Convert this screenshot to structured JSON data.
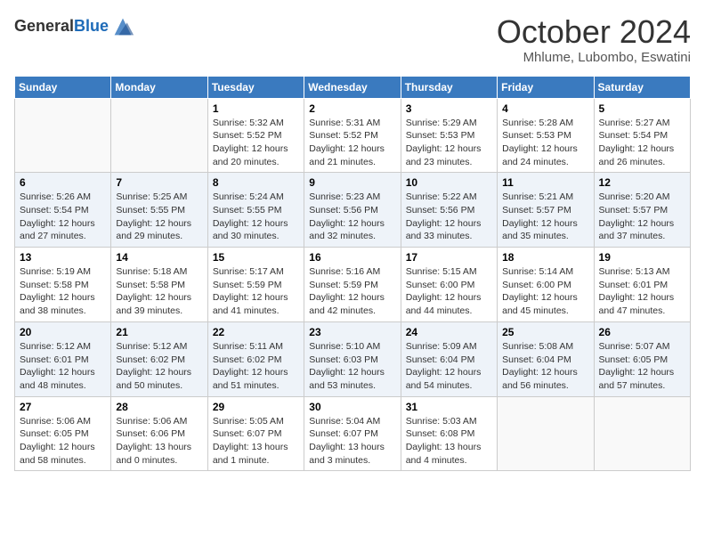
{
  "header": {
    "logo_general": "General",
    "logo_blue": "Blue",
    "month_title": "October 2024",
    "location": "Mhlume, Lubombo, Eswatini"
  },
  "weekdays": [
    "Sunday",
    "Monday",
    "Tuesday",
    "Wednesday",
    "Thursday",
    "Friday",
    "Saturday"
  ],
  "weeks": [
    [
      {
        "day": "",
        "sunrise": "",
        "sunset": "",
        "daylight": ""
      },
      {
        "day": "",
        "sunrise": "",
        "sunset": "",
        "daylight": ""
      },
      {
        "day": "1",
        "sunrise": "Sunrise: 5:32 AM",
        "sunset": "Sunset: 5:52 PM",
        "daylight": "Daylight: 12 hours and 20 minutes."
      },
      {
        "day": "2",
        "sunrise": "Sunrise: 5:31 AM",
        "sunset": "Sunset: 5:52 PM",
        "daylight": "Daylight: 12 hours and 21 minutes."
      },
      {
        "day": "3",
        "sunrise": "Sunrise: 5:29 AM",
        "sunset": "Sunset: 5:53 PM",
        "daylight": "Daylight: 12 hours and 23 minutes."
      },
      {
        "day": "4",
        "sunrise": "Sunrise: 5:28 AM",
        "sunset": "Sunset: 5:53 PM",
        "daylight": "Daylight: 12 hours and 24 minutes."
      },
      {
        "day": "5",
        "sunrise": "Sunrise: 5:27 AM",
        "sunset": "Sunset: 5:54 PM",
        "daylight": "Daylight: 12 hours and 26 minutes."
      }
    ],
    [
      {
        "day": "6",
        "sunrise": "Sunrise: 5:26 AM",
        "sunset": "Sunset: 5:54 PM",
        "daylight": "Daylight: 12 hours and 27 minutes."
      },
      {
        "day": "7",
        "sunrise": "Sunrise: 5:25 AM",
        "sunset": "Sunset: 5:55 PM",
        "daylight": "Daylight: 12 hours and 29 minutes."
      },
      {
        "day": "8",
        "sunrise": "Sunrise: 5:24 AM",
        "sunset": "Sunset: 5:55 PM",
        "daylight": "Daylight: 12 hours and 30 minutes."
      },
      {
        "day": "9",
        "sunrise": "Sunrise: 5:23 AM",
        "sunset": "Sunset: 5:56 PM",
        "daylight": "Daylight: 12 hours and 32 minutes."
      },
      {
        "day": "10",
        "sunrise": "Sunrise: 5:22 AM",
        "sunset": "Sunset: 5:56 PM",
        "daylight": "Daylight: 12 hours and 33 minutes."
      },
      {
        "day": "11",
        "sunrise": "Sunrise: 5:21 AM",
        "sunset": "Sunset: 5:57 PM",
        "daylight": "Daylight: 12 hours and 35 minutes."
      },
      {
        "day": "12",
        "sunrise": "Sunrise: 5:20 AM",
        "sunset": "Sunset: 5:57 PM",
        "daylight": "Daylight: 12 hours and 37 minutes."
      }
    ],
    [
      {
        "day": "13",
        "sunrise": "Sunrise: 5:19 AM",
        "sunset": "Sunset: 5:58 PM",
        "daylight": "Daylight: 12 hours and 38 minutes."
      },
      {
        "day": "14",
        "sunrise": "Sunrise: 5:18 AM",
        "sunset": "Sunset: 5:58 PM",
        "daylight": "Daylight: 12 hours and 39 minutes."
      },
      {
        "day": "15",
        "sunrise": "Sunrise: 5:17 AM",
        "sunset": "Sunset: 5:59 PM",
        "daylight": "Daylight: 12 hours and 41 minutes."
      },
      {
        "day": "16",
        "sunrise": "Sunrise: 5:16 AM",
        "sunset": "Sunset: 5:59 PM",
        "daylight": "Daylight: 12 hours and 42 minutes."
      },
      {
        "day": "17",
        "sunrise": "Sunrise: 5:15 AM",
        "sunset": "Sunset: 6:00 PM",
        "daylight": "Daylight: 12 hours and 44 minutes."
      },
      {
        "day": "18",
        "sunrise": "Sunrise: 5:14 AM",
        "sunset": "Sunset: 6:00 PM",
        "daylight": "Daylight: 12 hours and 45 minutes."
      },
      {
        "day": "19",
        "sunrise": "Sunrise: 5:13 AM",
        "sunset": "Sunset: 6:01 PM",
        "daylight": "Daylight: 12 hours and 47 minutes."
      }
    ],
    [
      {
        "day": "20",
        "sunrise": "Sunrise: 5:12 AM",
        "sunset": "Sunset: 6:01 PM",
        "daylight": "Daylight: 12 hours and 48 minutes."
      },
      {
        "day": "21",
        "sunrise": "Sunrise: 5:12 AM",
        "sunset": "Sunset: 6:02 PM",
        "daylight": "Daylight: 12 hours and 50 minutes."
      },
      {
        "day": "22",
        "sunrise": "Sunrise: 5:11 AM",
        "sunset": "Sunset: 6:02 PM",
        "daylight": "Daylight: 12 hours and 51 minutes."
      },
      {
        "day": "23",
        "sunrise": "Sunrise: 5:10 AM",
        "sunset": "Sunset: 6:03 PM",
        "daylight": "Daylight: 12 hours and 53 minutes."
      },
      {
        "day": "24",
        "sunrise": "Sunrise: 5:09 AM",
        "sunset": "Sunset: 6:04 PM",
        "daylight": "Daylight: 12 hours and 54 minutes."
      },
      {
        "day": "25",
        "sunrise": "Sunrise: 5:08 AM",
        "sunset": "Sunset: 6:04 PM",
        "daylight": "Daylight: 12 hours and 56 minutes."
      },
      {
        "day": "26",
        "sunrise": "Sunrise: 5:07 AM",
        "sunset": "Sunset: 6:05 PM",
        "daylight": "Daylight: 12 hours and 57 minutes."
      }
    ],
    [
      {
        "day": "27",
        "sunrise": "Sunrise: 5:06 AM",
        "sunset": "Sunset: 6:05 PM",
        "daylight": "Daylight: 12 hours and 58 minutes."
      },
      {
        "day": "28",
        "sunrise": "Sunrise: 5:06 AM",
        "sunset": "Sunset: 6:06 PM",
        "daylight": "Daylight: 13 hours and 0 minutes."
      },
      {
        "day": "29",
        "sunrise": "Sunrise: 5:05 AM",
        "sunset": "Sunset: 6:07 PM",
        "daylight": "Daylight: 13 hours and 1 minute."
      },
      {
        "day": "30",
        "sunrise": "Sunrise: 5:04 AM",
        "sunset": "Sunset: 6:07 PM",
        "daylight": "Daylight: 13 hours and 3 minutes."
      },
      {
        "day": "31",
        "sunrise": "Sunrise: 5:03 AM",
        "sunset": "Sunset: 6:08 PM",
        "daylight": "Daylight: 13 hours and 4 minutes."
      },
      {
        "day": "",
        "sunrise": "",
        "sunset": "",
        "daylight": ""
      },
      {
        "day": "",
        "sunrise": "",
        "sunset": "",
        "daylight": ""
      }
    ]
  ]
}
